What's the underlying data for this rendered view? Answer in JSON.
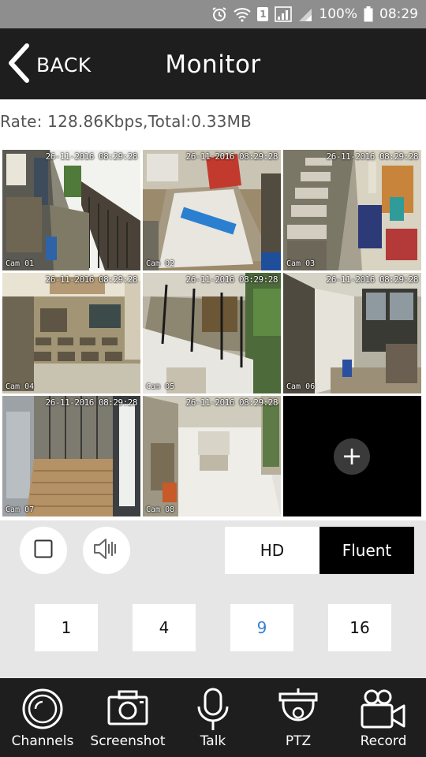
{
  "status_bar": {
    "sim_label": "1",
    "battery": "100%",
    "time": "08:29",
    "icons": [
      "alarm-icon",
      "wifi-icon",
      "signal-icon",
      "signal-icon",
      "battery-icon"
    ]
  },
  "header": {
    "back_label": "BACK",
    "title": "Monitor"
  },
  "rate_text": "Rate: 128.86Kbps,Total:0.33MB",
  "cameras": [
    {
      "name": "Cam 01",
      "timestamp": "26-11-2016 08:29:28"
    },
    {
      "name": "Cam 02",
      "timestamp": "26-11-2016 08:29:28"
    },
    {
      "name": "Cam 03",
      "timestamp": "26-11-2016 08:29:28"
    },
    {
      "name": "Cam 04",
      "timestamp": "26-11-2016 08:29:28"
    },
    {
      "name": "Cam 05",
      "timestamp": "26-11-2016 08:29:28"
    },
    {
      "name": "Cam 06",
      "timestamp": "26-11-2016 08:29:28"
    },
    {
      "name": "Cam 07",
      "timestamp": "26-11-2016 08:29:28"
    },
    {
      "name": "Cam 08",
      "timestamp": "26-11-2016 08:29:28"
    }
  ],
  "add_slot_symbol": "+",
  "quality": {
    "hd_label": "HD",
    "fluent_label": "Fluent",
    "selected": "Fluent"
  },
  "split_options": [
    "1",
    "4",
    "9",
    "16"
  ],
  "split_selected": "9",
  "bottom_nav": [
    {
      "label": "Channels",
      "icon": "channels-icon"
    },
    {
      "label": "Screenshot",
      "icon": "camera-icon"
    },
    {
      "label": "Talk",
      "icon": "microphone-icon"
    },
    {
      "label": "PTZ",
      "icon": "ptz-dome-icon"
    },
    {
      "label": "Record",
      "icon": "video-camera-icon"
    }
  ],
  "colors": {
    "header_bg": "#1e1e1e",
    "status_bar_bg": "#8e8e8e",
    "selected_outline": "#56d1cf",
    "active_split": "#3a7fd0",
    "controls_bg": "#e6e6e6"
  }
}
